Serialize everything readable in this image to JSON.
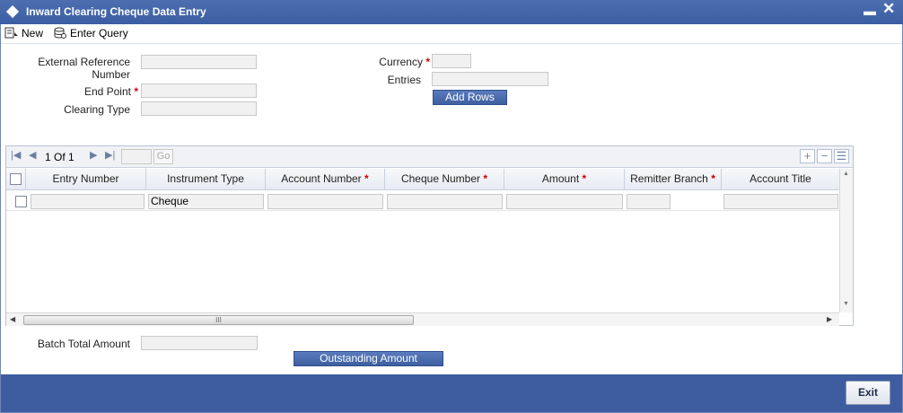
{
  "window": {
    "title": "Inward Clearing Cheque Data Entry"
  },
  "toolbar": {
    "new_label": "New",
    "enter_query_label": "Enter Query"
  },
  "form": {
    "ext_ref_label_1": "External Reference",
    "ext_ref_label_2": "Number",
    "end_point_label": "End Point",
    "clearing_type_label": "Clearing Type",
    "currency_label": "Currency",
    "entries_label": "Entries",
    "required_mark": "*",
    "add_rows_label": "Add Rows"
  },
  "grid": {
    "pager": {
      "current": "1",
      "of_label": "Of",
      "total": "1",
      "go_label": "Go"
    },
    "columns": [
      "Entry Number",
      "Instrument Type",
      "Account Number",
      "Cheque Number",
      "Amount",
      "Remitter Branch",
      "Account Title"
    ],
    "rows": [
      {
        "instrument_type": "Cheque"
      }
    ],
    "hscroll_grip": "III"
  },
  "bottom": {
    "batch_total_label": "Batch Total Amount",
    "outstanding_label": "Outstanding Amount"
  },
  "footer": {
    "exit_label": "Exit"
  },
  "colors": {
    "title_bar": "#3b5ea3",
    "footer": "#3d5da0",
    "required": "#cc0000"
  }
}
